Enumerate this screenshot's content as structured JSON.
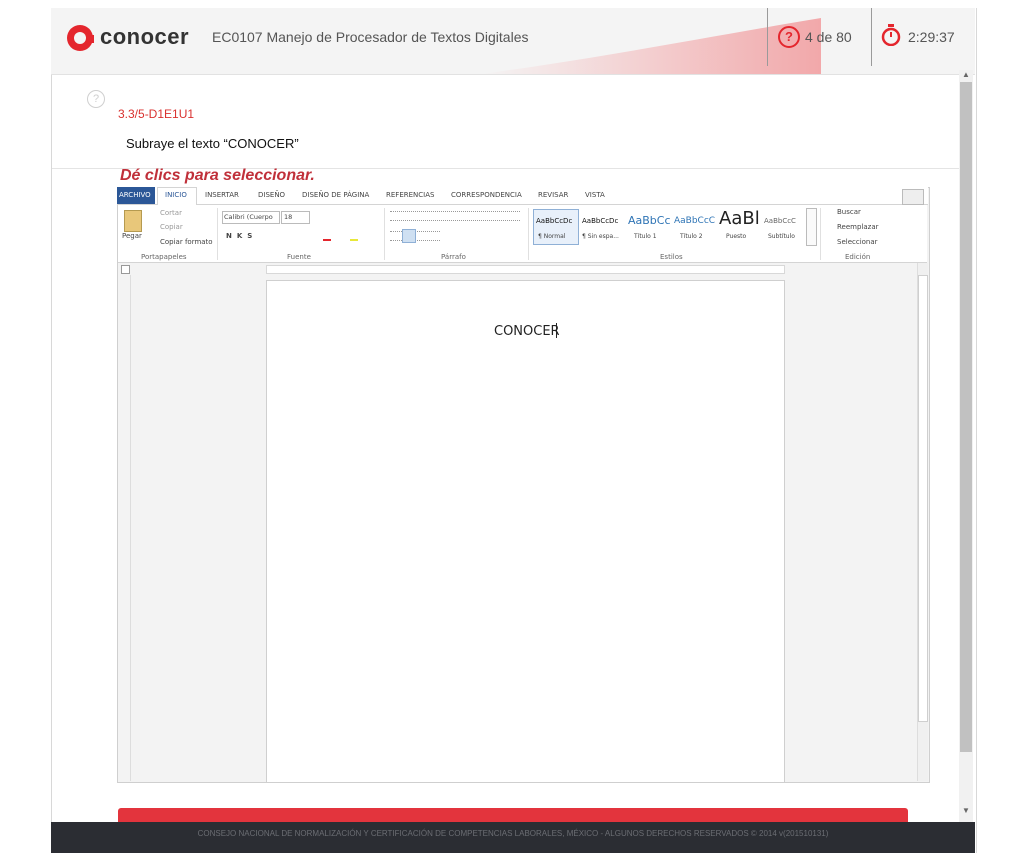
{
  "header": {
    "logo_text": "conocer",
    "course_title": "EC0107 Manejo de Procesador de Textos Digitales",
    "question_counter": "4 de 80",
    "timer": "2:29:37"
  },
  "question": {
    "help_symbol": "?",
    "code": "3.3/5-D1E1U1",
    "prompt": "Subraye el texto “CONOCER”",
    "instruction": "Dé clics para seleccionar."
  },
  "word": {
    "tabs": [
      "ARCHIVO",
      "INICIO",
      "INSERTAR",
      "DISEÑO",
      "DISEÑO DE PÁGINA",
      "REFERENCIAS",
      "CORRESPONDENCIA",
      "REVISAR",
      "VISTA"
    ],
    "clipboard": {
      "paste": "Pegar",
      "cut": "Cortar",
      "copy": "Copiar",
      "format_painter": "Copiar formato",
      "group": "Portapapeles"
    },
    "font": {
      "name": "Calibri (Cuerpo",
      "size": "18",
      "group": "Fuente"
    },
    "paragraph_group": "Párrafo",
    "styles": [
      {
        "preview": "AaBbCcDc",
        "name": "¶ Normal"
      },
      {
        "preview": "AaBbCcDc",
        "name": "¶ Sin espa..."
      },
      {
        "preview": "AaBbCc",
        "name": "Título 1"
      },
      {
        "preview": "AaBbCcC",
        "name": "Título 2"
      },
      {
        "preview": "AaBl",
        "name": "Puesto"
      },
      {
        "preview": "AaBbCcC",
        "name": "Subtítulo"
      }
    ],
    "styles_group": "Estilos",
    "editing": {
      "find": "Buscar",
      "replace": "Reemplazar",
      "select": "Seleccionar",
      "group": "Edición"
    },
    "document_text": "CONOCER"
  },
  "footer": {
    "text": "CONSEJO NACIONAL DE NORMALIZACIÓN Y CERTIFICACIÓN DE COMPETENCIAS LABORALES, MÉXICO - ALGUNOS DERECHOS RESERVADOS © 2014 v(201510131)"
  },
  "colors": {
    "brand_red": "#e4262d",
    "instruction_red": "#c0303a",
    "word_blue": "#2b5797"
  }
}
